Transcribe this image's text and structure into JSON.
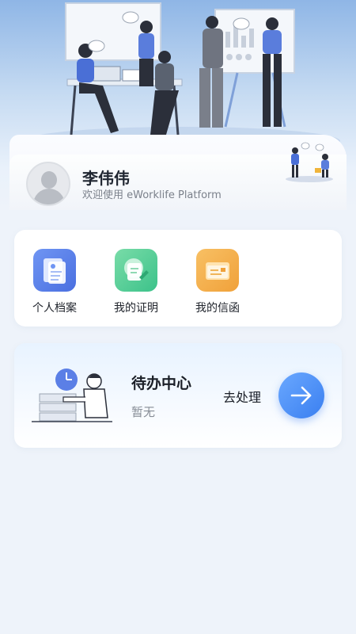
{
  "profile": {
    "name": "李伟伟",
    "welcome": "欢迎使用 eWorklife Platform"
  },
  "quick_links": [
    {
      "label": "个人档案",
      "icon": "personal-file-icon",
      "color": "#4f79e6"
    },
    {
      "label": "我的证明",
      "icon": "certificate-icon",
      "color": "#3cc28a"
    },
    {
      "label": "我的信函",
      "icon": "letter-icon",
      "color": "#f0a13a"
    }
  ],
  "todo": {
    "title": "待办中心",
    "status": "暂无",
    "action": "去处理",
    "accent": "#3a7ff0"
  }
}
